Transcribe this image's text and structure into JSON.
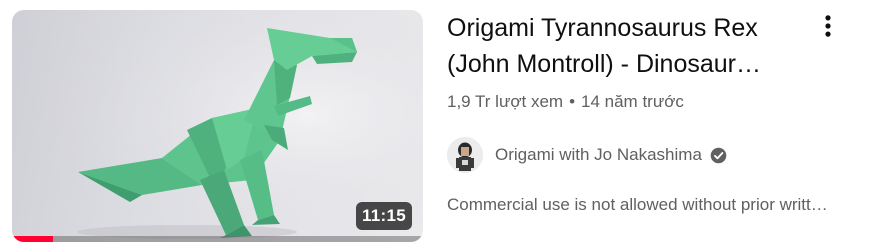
{
  "video": {
    "title": "Origami Tyrannosaurus Rex (John Montroll) - Dinosaur…",
    "views": "1,9 Tr lượt xem",
    "separator": "•",
    "age": "14 năm trước",
    "duration": "11:15",
    "progress": 0.1,
    "description": "Commercial use is not allowed without prior writt…"
  },
  "channel": {
    "name": "Origami with Jo Nakashima",
    "verified": true
  },
  "icons": {
    "menu": "more-vert-icon",
    "verified": "verified-check-icon",
    "avatar": "channel-avatar"
  },
  "colors": {
    "progress": "#ff0033",
    "paper_green": "#5cc48c",
    "text_primary": "#0f0f0f",
    "text_secondary": "#606060"
  }
}
